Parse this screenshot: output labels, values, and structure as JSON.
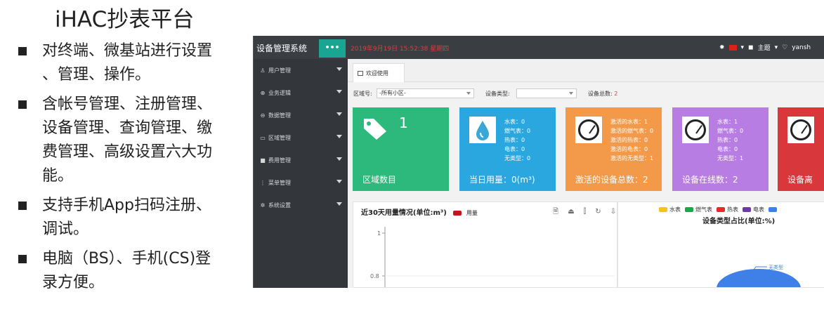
{
  "slide": {
    "title": "iHAC抄表平台",
    "bullets": [
      {
        "lines": [
          "对终端、微基站进行设置",
          "、管理、操作。"
        ]
      },
      {
        "lines": [
          "含帐号管理、注册管理、",
          "设备管理、查询管理、缴",
          "费管理、高级设置六大功",
          "能。"
        ]
      },
      {
        "lines": [
          "支持手机App扫码注册、",
          "调试。"
        ]
      },
      {
        "lines": [
          "电脑（BS）、手机(CS)登",
          "录方便。"
        ]
      }
    ]
  },
  "app": {
    "brand": "设备管理系统",
    "more_button": "•••",
    "datetime": "2019年9月19日 15:52:38 星期四",
    "topbar_right": {
      "theme": "主题",
      "user": "yansh"
    },
    "sidebar": [
      {
        "icon": "user-icon",
        "glyph": "♙",
        "label": "用户管理"
      },
      {
        "icon": "logic-icon",
        "glyph": "⊕",
        "label": "业务逻辑"
      },
      {
        "icon": "data-icon",
        "glyph": "⊖",
        "label": "数据管理"
      },
      {
        "icon": "region-icon",
        "glyph": "▭",
        "label": "区域管理"
      },
      {
        "icon": "fee-icon",
        "glyph": "■",
        "label": "费用管理"
      },
      {
        "icon": "menu-icon",
        "glyph": "⋮",
        "label": "菜单管理"
      },
      {
        "icon": "settings-icon",
        "glyph": "✲",
        "label": "系统设置"
      }
    ],
    "tab": {
      "label": "欢迎使用"
    },
    "filters": {
      "region_label": "区域号:",
      "region_value": "-所有小区-",
      "device_type_label": "设备类型:",
      "device_type_value": "",
      "device_total_label": "设备总数:",
      "device_total_value": "2"
    },
    "cards": [
      {
        "color": "#2db97c",
        "big_number": "1",
        "bottom": "区域数目",
        "stats": []
      },
      {
        "color": "#2aa7df",
        "bottom": "当日用量：0(m³)",
        "stats": [
          "水表：0",
          "燃气表：0",
          "热表：0",
          "电表：0",
          "无类型：0"
        ]
      },
      {
        "color": "#f39a4a",
        "bottom": "激活的设备总数：2",
        "stats": [
          "激活的水表：1",
          "激活的燃气表：0",
          "激活的热表：0",
          "激活的电表：0",
          "激活的无类型：1"
        ]
      },
      {
        "color": "#b87de3",
        "bottom": "设备在线数：2",
        "stats": [
          "水表：1",
          "燃气表：0",
          "热表：0",
          "电表：0",
          "无类型：1"
        ]
      },
      {
        "color": "#d8383b",
        "bottom": "设备离",
        "stats": []
      }
    ],
    "usage_panel": {
      "title": "近30天用量情况(单位:m³)",
      "legend": "用量",
      "legend_color": "#c0161d",
      "tools": "🗎 ⏏ ⫿ ↻ ⇩",
      "y_ticks": [
        "1",
        "0.8"
      ]
    },
    "pie_panel": {
      "title": "设备类型占比(单位:%)",
      "legend": [
        {
          "name": "水表",
          "color": "#f7c21e"
        },
        {
          "name": "燃气表",
          "color": "#19a84a"
        },
        {
          "name": "热表",
          "color": "#e8282b"
        },
        {
          "name": "电表",
          "color": "#6e3aa3"
        },
        {
          "name": "",
          "color": "#3f7fe8"
        }
      ],
      "slice_label": "无类型"
    }
  }
}
